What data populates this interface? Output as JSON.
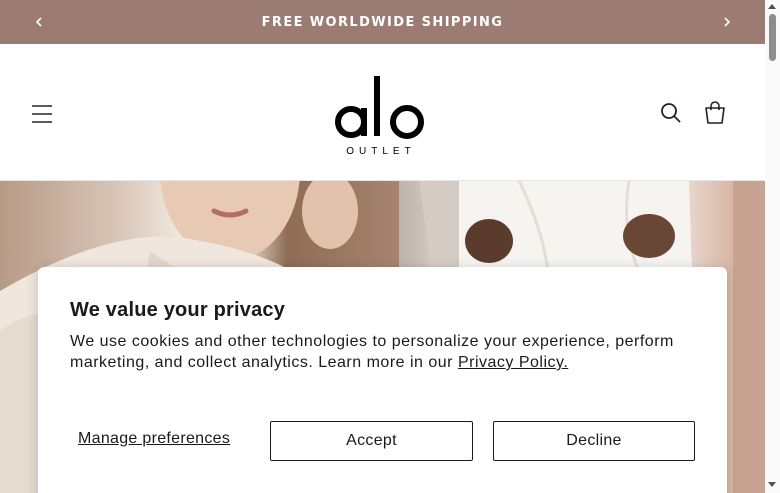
{
  "announcement": {
    "text": "FREE WORLDWIDE SHIPPING",
    "prev_icon": "chevron-left-icon",
    "next_icon": "chevron-right-icon",
    "background_color": "#9c7b72"
  },
  "header": {
    "logo_text": "alo",
    "logo_subtext": "OUTLET",
    "menu_icon": "hamburger-menu-icon",
    "search_icon": "search-icon",
    "cart_icon": "cart-icon"
  },
  "privacy_modal": {
    "title": "We value your privacy",
    "body": "We use cookies and other technologies to personalize your experience, perform marketing, and collect analytics. Learn more in our ",
    "link_text": "Privacy Policy.",
    "manage_label": "Manage preferences",
    "accept_label": "Accept",
    "decline_label": "Decline"
  }
}
